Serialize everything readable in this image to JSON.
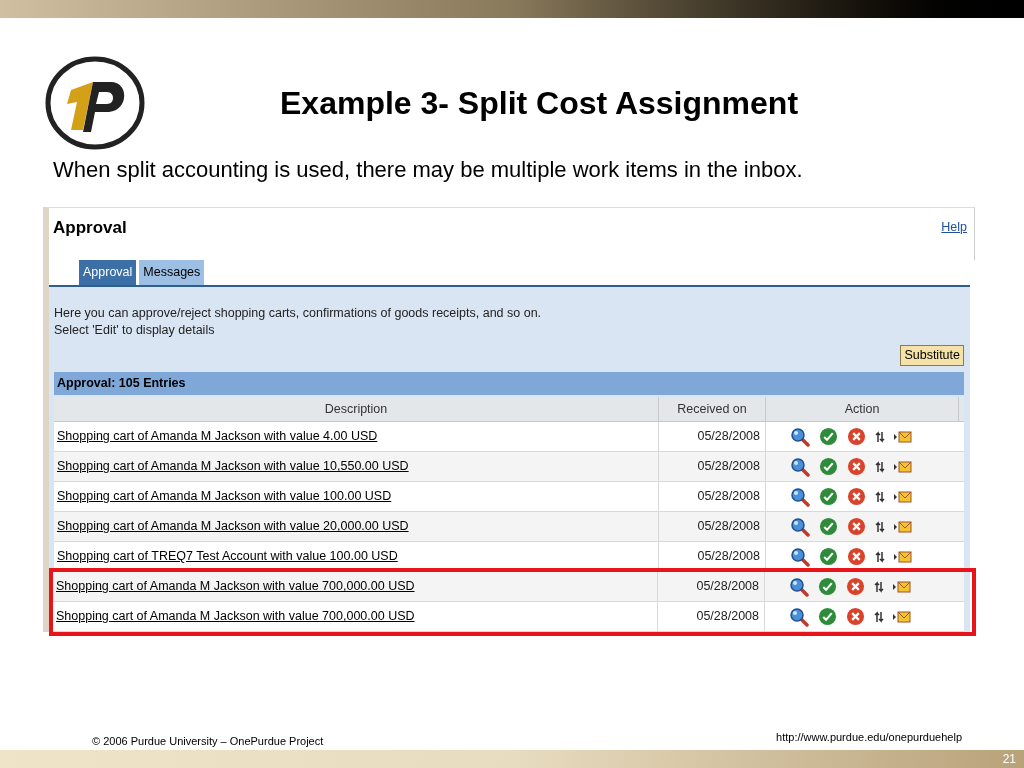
{
  "slide": {
    "title": "Example 3- Split Cost Assignment",
    "subtitle": "When split accounting is used, there may be multiple work items in the inbox.",
    "footer_left": "© 2006 Purdue University – OnePurdue Project",
    "footer_right": "http://www.purdue.edu/onepurduehelp",
    "page_number": "21"
  },
  "app": {
    "title": "Approval",
    "help_link": "Help",
    "tabs": [
      {
        "label": "Approval",
        "selected": true
      },
      {
        "label": "Messages",
        "selected": false
      }
    ],
    "intro": [
      "Here you can approve/reject shopping carts, confirmations of goods receipts, and so on.",
      "Select 'Edit' to display details"
    ],
    "substitute_button": "Substitute",
    "table": {
      "title": "Approval:  105 Entries",
      "columns": [
        "Description",
        "Received on",
        "Action"
      ],
      "rows": [
        {
          "description": "Shopping cart of Amanda M Jackson with value 4.00 USD",
          "received_on": "05/28/2008",
          "highlighted": false
        },
        {
          "description": "Shopping cart of Amanda M Jackson with value 10,550.00 USD",
          "received_on": "05/28/2008",
          "highlighted": false
        },
        {
          "description": "Shopping cart of Amanda M Jackson with value 100.00 USD",
          "received_on": "05/28/2008",
          "highlighted": false
        },
        {
          "description": "Shopping cart of Amanda M Jackson with value 20,000.00 USD",
          "received_on": "05/28/2008",
          "highlighted": false
        },
        {
          "description": "Shopping cart of TREQ7 Test Account with value 100.00 USD",
          "received_on": "05/28/2008",
          "highlighted": false
        },
        {
          "description": "Shopping cart of Amanda M Jackson with value 700,000.00 USD",
          "received_on": "05/28/2008",
          "highlighted": true
        },
        {
          "description": "Shopping cart of Amanda M Jackson with value 700,000.00 USD",
          "received_on": "05/28/2008",
          "highlighted": true
        }
      ]
    }
  }
}
